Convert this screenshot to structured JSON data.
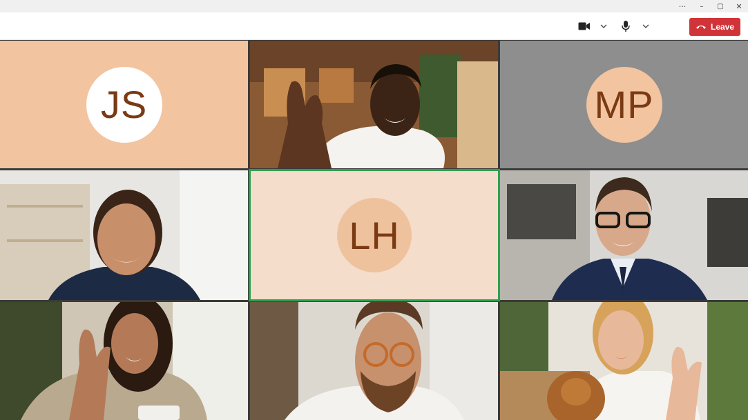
{
  "window": {
    "more_label": "···",
    "minimize_label": "–",
    "maximize_label": "▢",
    "close_label": "✕"
  },
  "toolbar": {
    "camera_icon": "camera-icon",
    "mic_icon": "microphone-icon",
    "leave_label": "Leave",
    "leave_color": "#d13438"
  },
  "participants": [
    {
      "initials": "JS",
      "type": "avatar",
      "tile_bg": "#f2c4a0",
      "avatar_bg": "#ffffff",
      "text_color": "#7a3a14"
    },
    {
      "type": "video",
      "description": "man waving"
    },
    {
      "initials": "MP",
      "type": "avatar",
      "tile_bg": "#8e8e8e",
      "avatar_bg": "#f2c4a0",
      "text_color": "#7a3a14"
    },
    {
      "type": "video",
      "description": "smiling woman"
    },
    {
      "initials": "LH",
      "type": "avatar",
      "tile_bg": "#f5ddcc",
      "avatar_bg": "#efc29e",
      "text_color": "#7a3a14",
      "active_speaker": true,
      "highlight_color": "#2ea04f"
    },
    {
      "type": "video",
      "description": "man in suit with glasses"
    },
    {
      "type": "video",
      "description": "woman waving holding mug"
    },
    {
      "type": "video",
      "description": "bearded man with glasses"
    },
    {
      "type": "video",
      "description": "woman waving with dog"
    }
  ]
}
